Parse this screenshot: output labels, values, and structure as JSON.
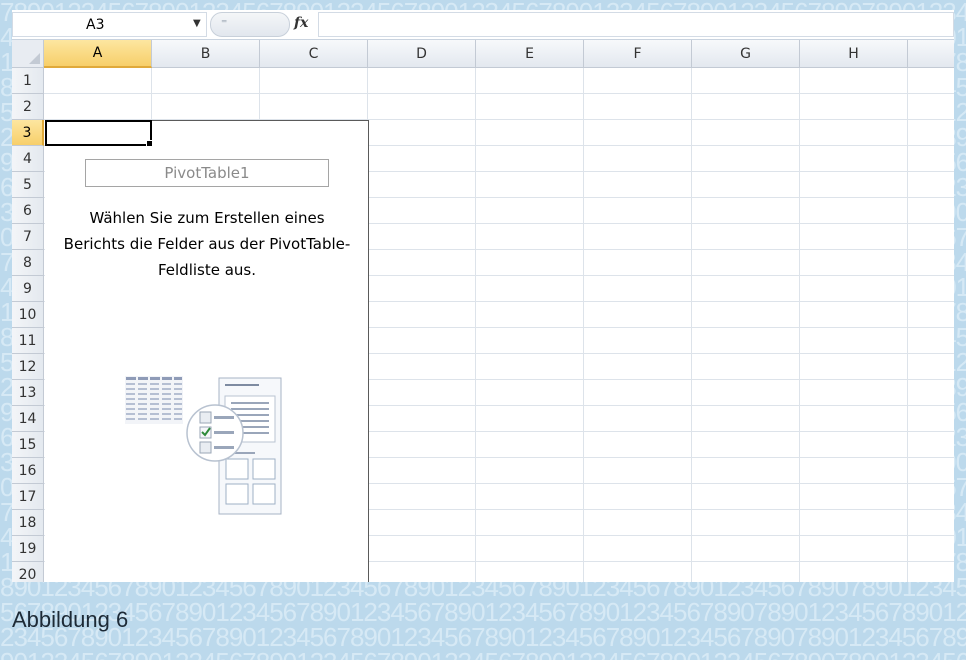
{
  "formula_bar": {
    "name_box_value": "A3",
    "formula_value": ""
  },
  "columns": [
    "A",
    "B",
    "C",
    "D",
    "E",
    "F",
    "G",
    "H"
  ],
  "rows": [
    "1",
    "2",
    "3",
    "4",
    "5",
    "6",
    "7",
    "8",
    "9",
    "10",
    "11",
    "12",
    "13",
    "14",
    "15",
    "16",
    "17",
    "18",
    "19",
    "20"
  ],
  "selected_column": "A",
  "selected_row": "3",
  "pivot": {
    "name": "PivotTable1",
    "message_lines": [
      "Wählen Sie zum Erstellen eines",
      "Berichts die Felder aus der PivotTable-",
      "Feldliste aus."
    ]
  },
  "caption": "Abbildung 6",
  "background_digits": "7890123456789012345678901234567890123456789012345678901234567890",
  "colors": {
    "selection_header": "#f7cf6a",
    "frame_background": "#bcd9ec",
    "checkbox_check": "#2e8b3a"
  }
}
